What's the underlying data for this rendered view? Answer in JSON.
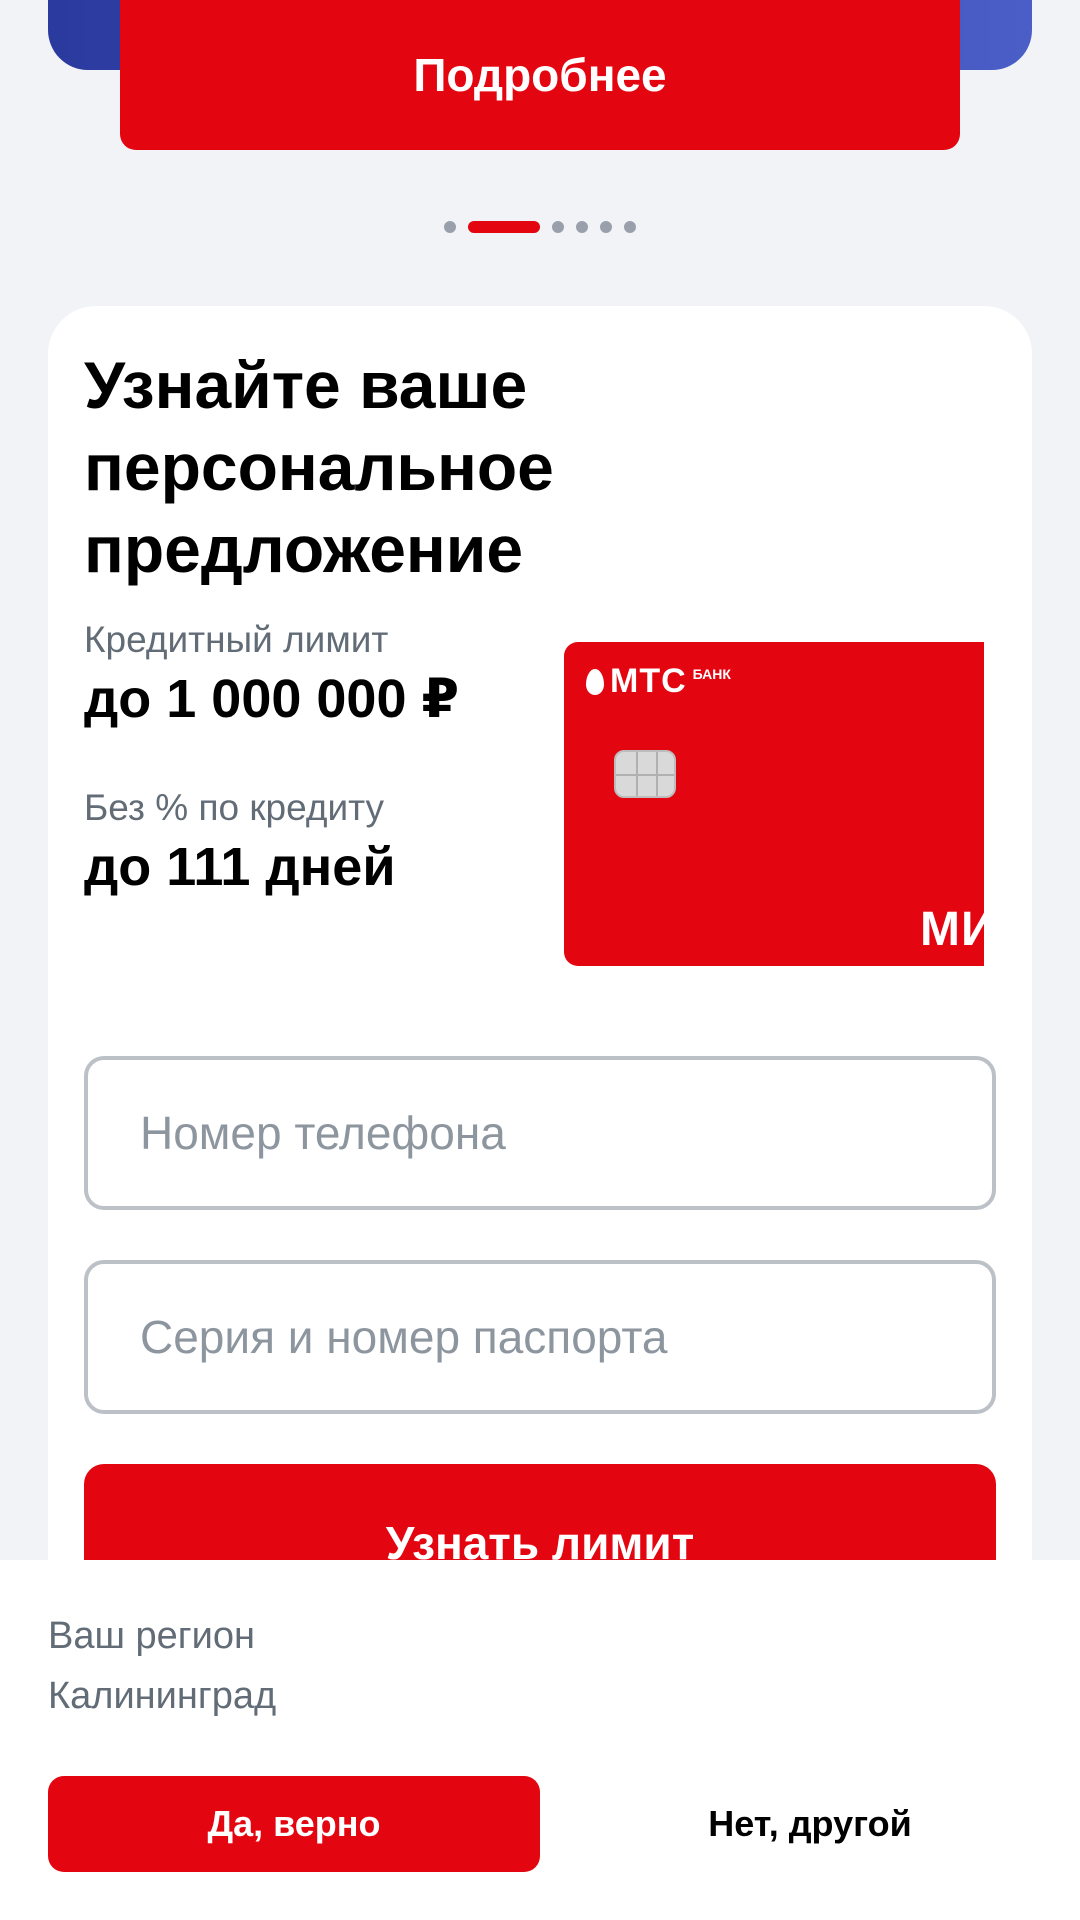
{
  "promo": {
    "more_button": "Подробнее"
  },
  "carousel": {
    "count": 6,
    "active_index": 1
  },
  "offer": {
    "title": "Узнайте ваше персональное предложение",
    "features": [
      {
        "label": "Кредитный лимит",
        "value": "до 1 000 000 ₽"
      },
      {
        "label": "Без % по кредиту",
        "value": "до 111 дней"
      }
    ],
    "card": {
      "logo": "МТС",
      "logo_sub": "БАНК",
      "brand": "МИ"
    },
    "phone_placeholder": "Номер телефона",
    "passport_placeholder": "Серия и номер паспорта",
    "submit_label": "Узнать лимит"
  },
  "region": {
    "label": "Ваш регион",
    "value": "Калининград",
    "confirm_label": "Да, верно",
    "other_label": "Нет, другой"
  },
  "colors": {
    "accent": "#e30611",
    "banner": "#3c4fb6",
    "muted_text": "#626c77"
  }
}
